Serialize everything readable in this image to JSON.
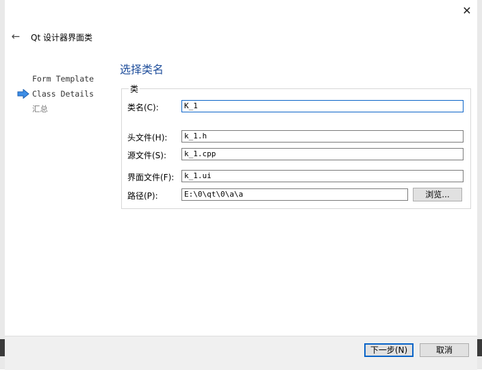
{
  "window": {
    "title": "Qt 设计器界面类",
    "close_glyph": "✕",
    "back_glyph": "←"
  },
  "steps": [
    {
      "label": "Form Template",
      "active": false
    },
    {
      "label": "Class Details",
      "active": true
    },
    {
      "label": "汇总",
      "active": false
    }
  ],
  "page": {
    "title": "选择类名",
    "group_title": "类",
    "class_name": {
      "label": "类名(C):",
      "value": "K_1"
    },
    "header_file": {
      "label": "头文件(H):",
      "value": "k_1.h"
    },
    "source_file": {
      "label": "源文件(S):",
      "value": "k_1.cpp"
    },
    "form_file": {
      "label": "界面文件(F):",
      "value": "k_1.ui"
    },
    "path": {
      "label": "路径(P):",
      "value": "E:\\0\\qt\\0\\a\\a"
    },
    "browse_label": "浏览..."
  },
  "footer": {
    "next_label": "下一步(N)",
    "cancel_label": "取消"
  },
  "colors": {
    "accent": "#0a64c8",
    "title": "#1f4e9b",
    "arrow": "#3d8ee6"
  }
}
